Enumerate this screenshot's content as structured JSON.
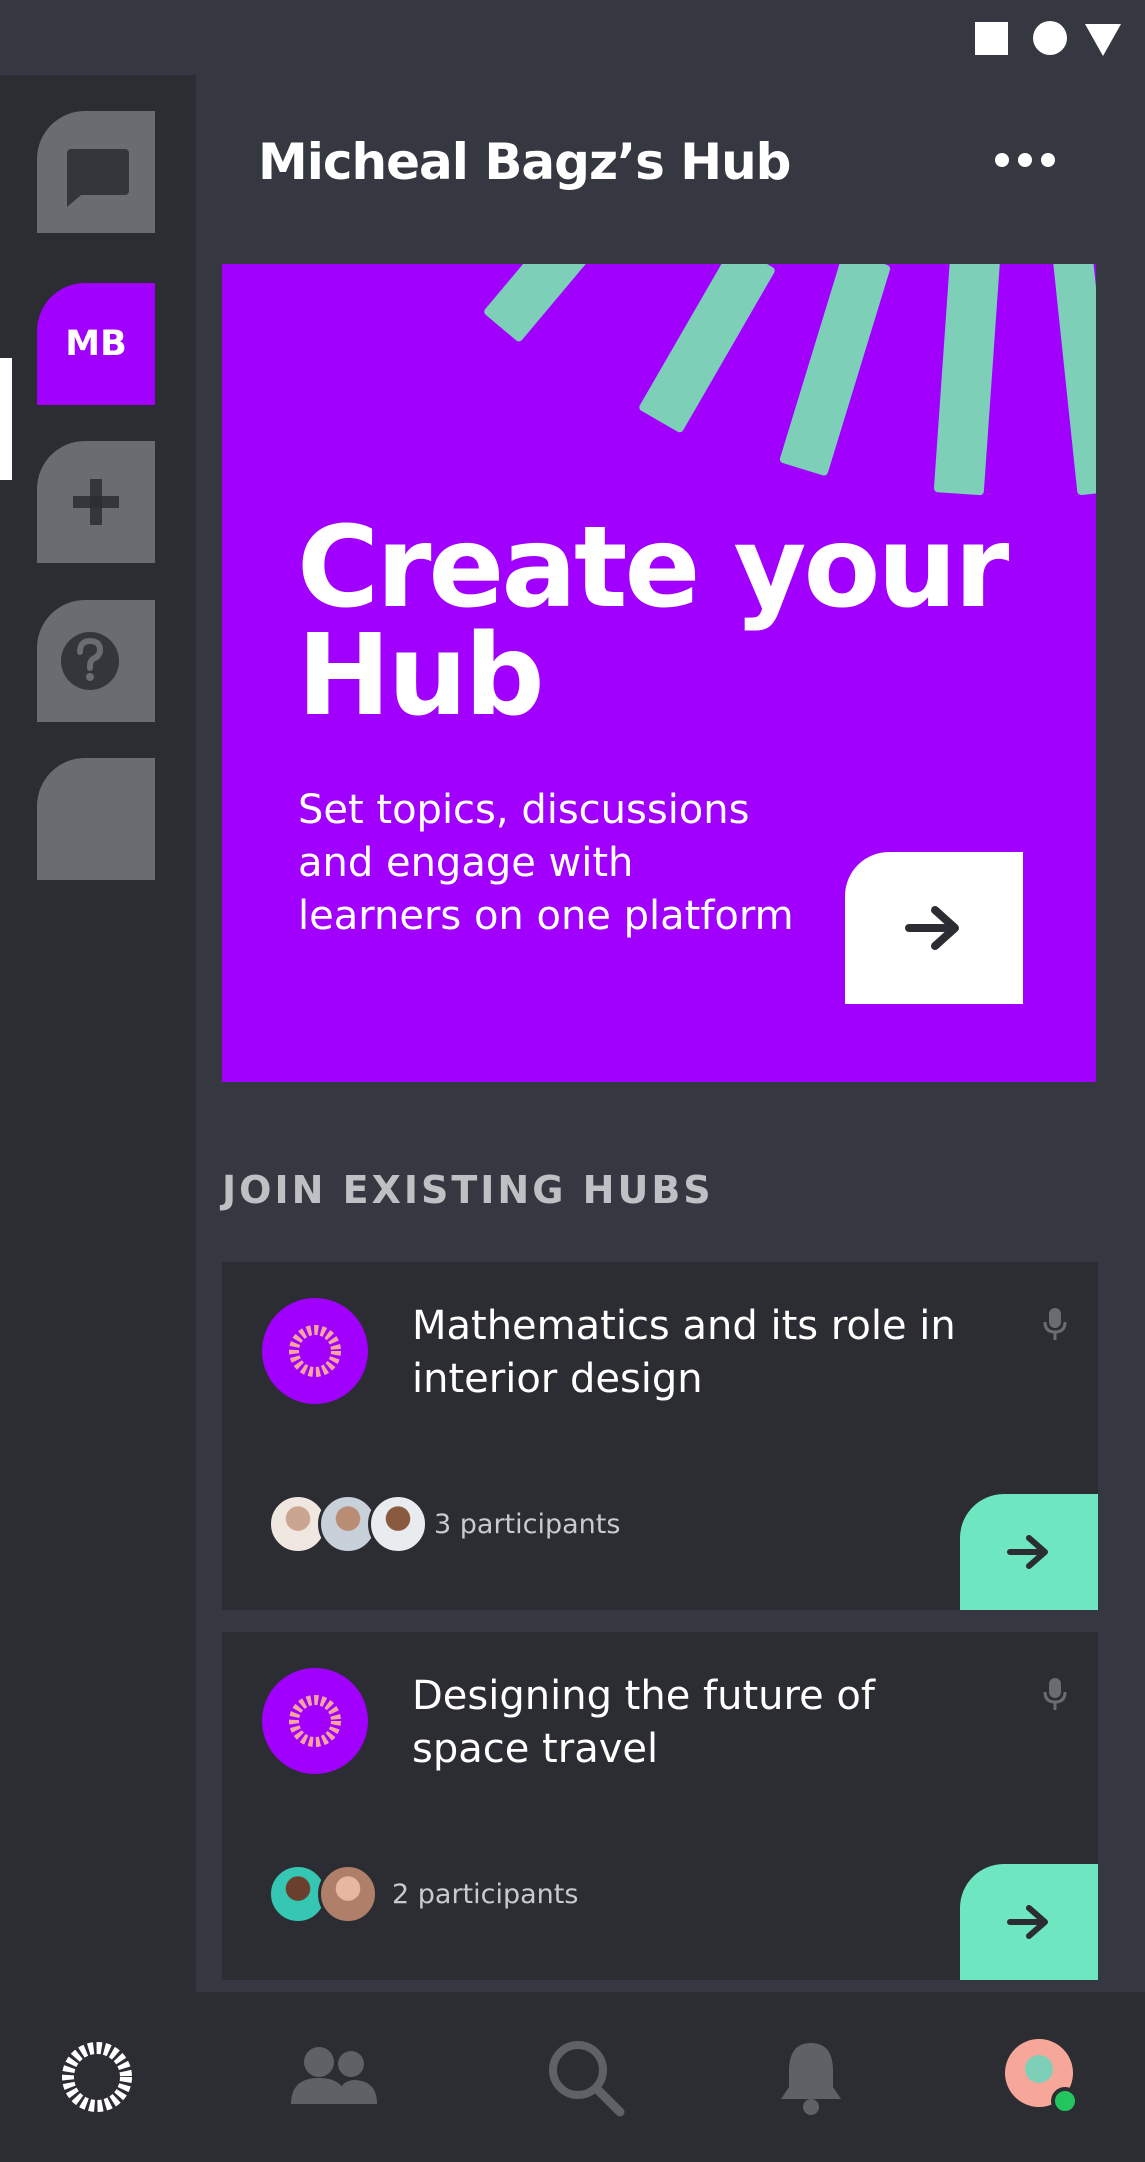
{
  "header": {
    "title": "Micheal Bagz’s Hub"
  },
  "sidebar": {
    "items": [
      {
        "name": "messages"
      },
      {
        "name": "my-hub",
        "label": "MB"
      },
      {
        "name": "add-hub"
      },
      {
        "name": "help"
      },
      {
        "name": "blank"
      }
    ]
  },
  "hero": {
    "title_line1": "Create your",
    "title_line2": "Hub",
    "description": "Set topics, discussions and engage with learners on one platform"
  },
  "section": {
    "label": "JOIN EXISTING HUBS"
  },
  "hubs": [
    {
      "title": "Mathematics and its role in interior design",
      "participants": "3 participants"
    },
    {
      "title": "Designing the future of space travel",
      "participants": "2 participants"
    }
  ],
  "colors": {
    "accent": "#a100ff",
    "mint": "#6ee7c1",
    "background": "#353841",
    "panel": "#2b2d33"
  },
  "bottom_nav": [
    "home-logo-icon",
    "people-icon",
    "search-icon",
    "bell-icon",
    "profile-avatar"
  ]
}
